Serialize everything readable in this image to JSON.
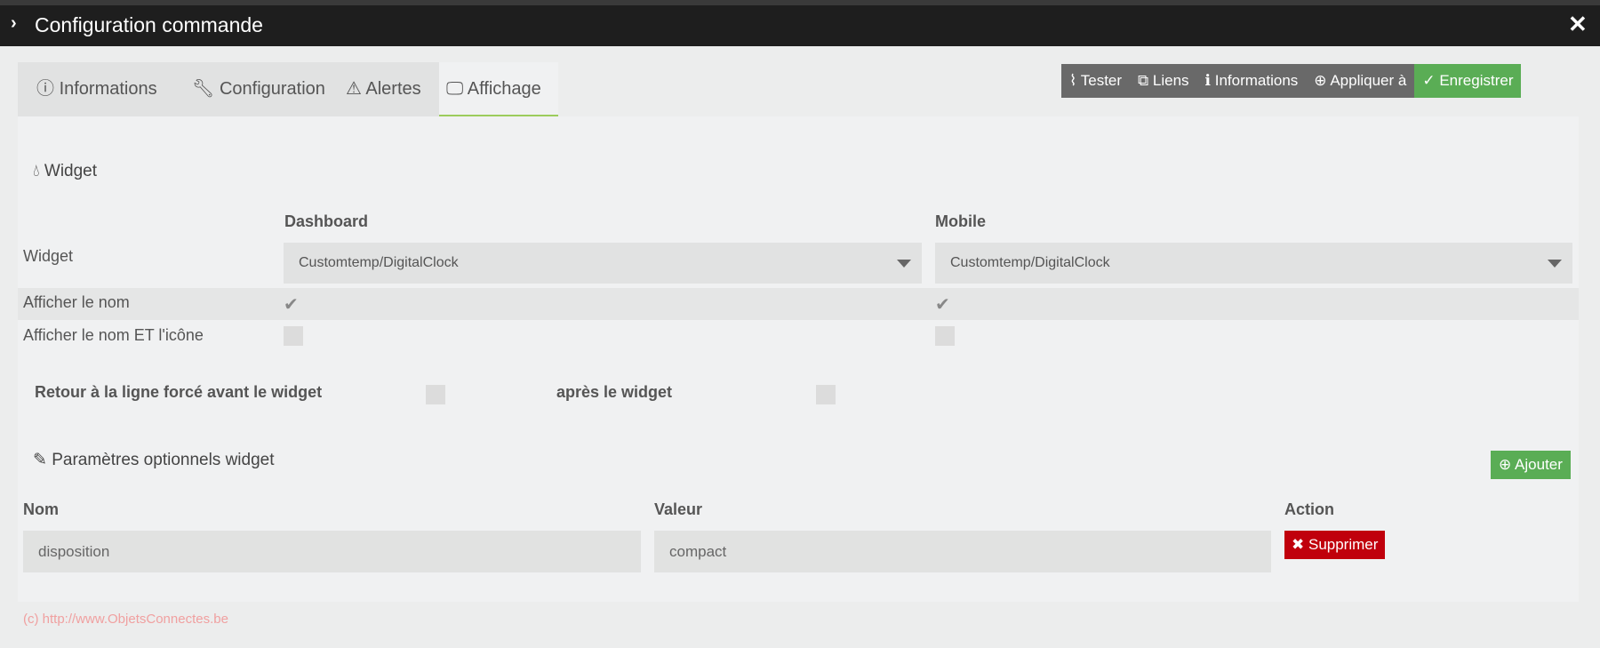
{
  "modal": {
    "title": "Configuration commande",
    "close_icon": "close-icon"
  },
  "tabs": [
    {
      "label": "Informations",
      "icon": "info-circle-icon"
    },
    {
      "label": "Configuration",
      "icon": "wrench-icon"
    },
    {
      "label": "Alertes",
      "icon": "warning-icon"
    },
    {
      "label": "Affichage",
      "icon": "monitor-icon",
      "active": true
    }
  ],
  "toolbar": {
    "tester": "Tester",
    "liens": "Liens",
    "informations": "Informations",
    "appliquer": "Appliquer à",
    "enregistrer": "Enregistrer"
  },
  "widget_section": {
    "title": "Widget",
    "col_dashboard": "Dashboard",
    "col_mobile": "Mobile",
    "rows": {
      "widget": "Widget",
      "afficher_nom": "Afficher le nom",
      "afficher_nom_icone": "Afficher le nom ET l'icône"
    },
    "dashboard_widget": "Customtemp/DigitalClock",
    "mobile_widget": "Customtemp/DigitalClock",
    "dashboard_afficher_nom": true,
    "mobile_afficher_nom": true,
    "dashboard_nom_icone": false,
    "mobile_nom_icone": false,
    "retour_avant": "Retour à la ligne forcé avant le widget",
    "retour_apres": "après le widget"
  },
  "params_section": {
    "title": "Paramètres optionnels widget",
    "add_label": "Ajouter",
    "headers": [
      "Nom",
      "Valeur",
      "Action"
    ],
    "rows": [
      {
        "nom": "disposition",
        "valeur": "compact",
        "action": "Supprimer"
      }
    ]
  },
  "footer": "(c) http://www.ObjetsConnectes.be",
  "colors": {
    "accent_green": "#5aad55",
    "danger": "#c0000c",
    "titlebar": "#1e1e1e"
  }
}
